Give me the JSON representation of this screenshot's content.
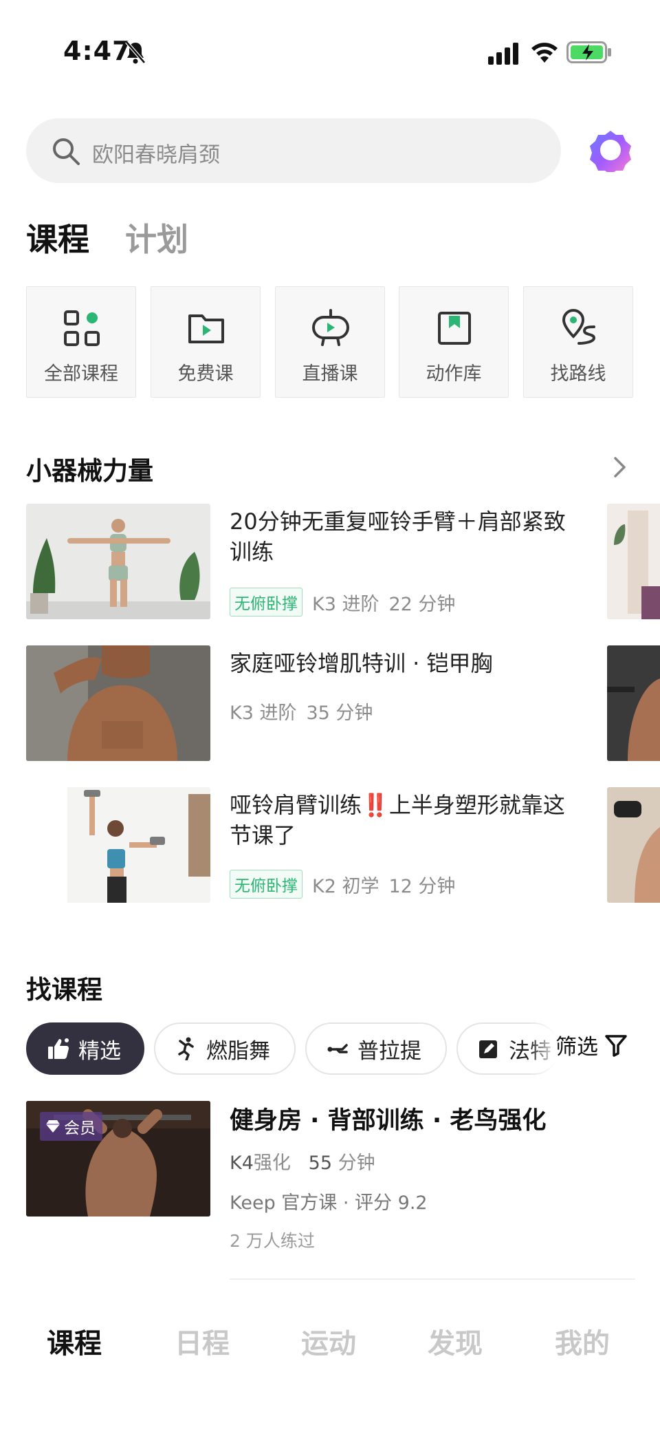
{
  "status": {
    "time": "4:47"
  },
  "search": {
    "placeholder": "欧阳春晓肩颈"
  },
  "tabs": {
    "active": "课程",
    "inactive": "计划"
  },
  "categories": [
    {
      "label": "全部课程",
      "icon": "grid-icon"
    },
    {
      "label": "免费课",
      "icon": "play-folder-icon"
    },
    {
      "label": "直播课",
      "icon": "live-tv-icon"
    },
    {
      "label": "动作库",
      "icon": "bookmark-icon"
    },
    {
      "label": "找路线",
      "icon": "route-pin-icon"
    }
  ],
  "section1": {
    "title": "小器械力量",
    "courses": [
      {
        "title": "20分钟无重复哑铃手臂＋肩部紧致训练",
        "tag": "无俯卧撑",
        "level": "K3 进阶",
        "duration": "22 分钟"
      },
      {
        "title": "家庭哑铃增肌特训 · 铠甲胸",
        "tag": "",
        "level": "K3 进阶",
        "duration": "35 分钟"
      },
      {
        "title": "哑铃肩臂训练‼️上半身塑形就靠这节课了",
        "tag": "无俯卧撑",
        "level": "K2 初学",
        "duration": "12 分钟"
      }
    ]
  },
  "section2": {
    "title": "找课程",
    "chips": [
      {
        "label": "精选",
        "icon": "thumbs-up-icon"
      },
      {
        "label": "燃脂舞",
        "icon": "dance-icon"
      },
      {
        "label": "普拉提",
        "icon": "pilates-icon"
      },
      {
        "label": "法特",
        "icon": "pen-icon"
      }
    ],
    "filter_label": "筛选",
    "featured": {
      "badge": "会员",
      "title": "健身房 · 背部训练 · 老鸟强化",
      "level_code": "K4",
      "level_text": "强化",
      "duration_num": "55",
      "duration_unit": "分钟",
      "source": "Keep 官方课 · 评分 9.2",
      "count": "2 万人练过"
    }
  },
  "bottom_nav": [
    "课程",
    "日程",
    "运动",
    "发现",
    "我的"
  ],
  "colors": {
    "accent_green": "#2bb673",
    "underline": "#5ad2a1",
    "chip_active": "#33313f"
  }
}
